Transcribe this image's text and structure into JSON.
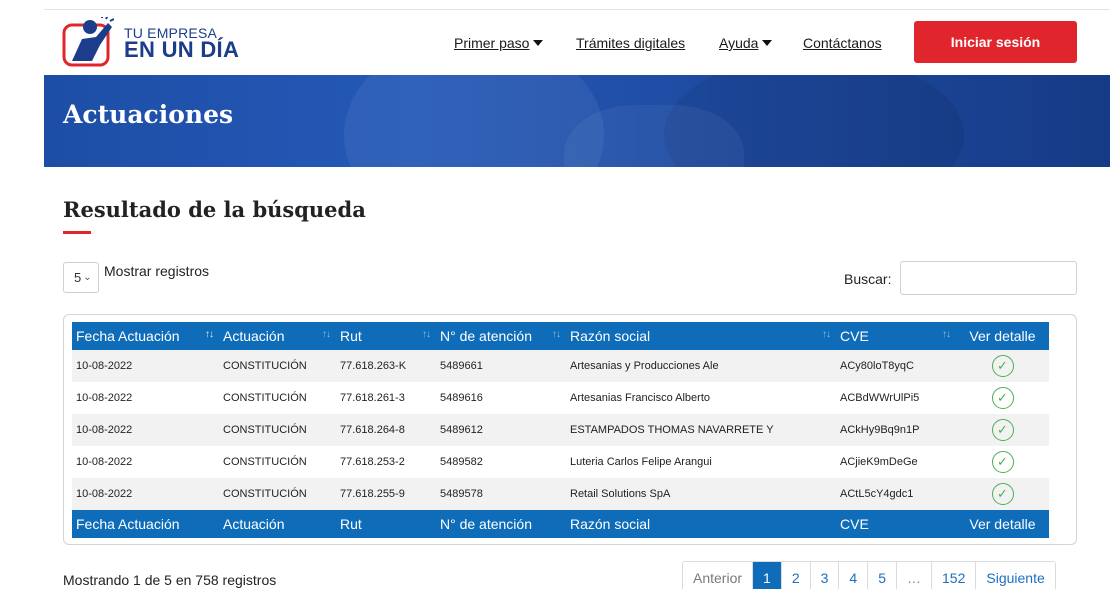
{
  "header": {
    "logo_line1": "TU EMPRESA",
    "logo_line2": "EN UN DÍA",
    "nav": [
      {
        "label": "Primer paso",
        "dropdown": true
      },
      {
        "label": "Trámites digitales",
        "dropdown": false
      },
      {
        "label": "Ayuda",
        "dropdown": true
      },
      {
        "label": "Contáctanos",
        "dropdown": false
      }
    ],
    "login_label": "Iniciar sesión"
  },
  "banner": {
    "title": "Actuaciones"
  },
  "section": {
    "title": "Resultado de la búsqueda"
  },
  "controls": {
    "page_length": "5",
    "page_length_label": "Mostrar registros",
    "search_label": "Buscar:",
    "search_value": ""
  },
  "table": {
    "columns": [
      "Fecha Actuación",
      "Actuación",
      "Rut",
      "N° de atención",
      "Razón social",
      "CVE",
      "Ver detalle"
    ],
    "rows": [
      [
        "10-08-2022",
        "CONSTITUCIÓN",
        "77.618.263-K",
        "5489661",
        "Artesanias y Producciones Ale",
        "ACy80loT8yqC"
      ],
      [
        "10-08-2022",
        "CONSTITUCIÓN",
        "77.618.261-3",
        "5489616",
        "Artesanias Francisco Alberto",
        "ACBdWWrUlPi5"
      ],
      [
        "10-08-2022",
        "CONSTITUCIÓN",
        "77.618.264-8",
        "5489612",
        "ESTAMPADOS THOMAS NAVARRETE Y",
        "ACkHy9Bq9n1P"
      ],
      [
        "10-08-2022",
        "CONSTITUCIÓN",
        "77.618.253-2",
        "5489582",
        "Luteria Carlos Felipe Arangui",
        "ACjieK9mDeGe"
      ],
      [
        "10-08-2022",
        "CONSTITUCIÓN",
        "77.618.255-9",
        "5489578",
        "Retail Solutions SpA",
        "ACtL5cY4gdc1"
      ]
    ]
  },
  "footer": {
    "info": "Mostrando 1 de 5 en 758 registros",
    "pagination": {
      "previous": "Anterior",
      "pages": [
        "1",
        "2",
        "3",
        "4",
        "5",
        "…",
        "152"
      ],
      "current": "1",
      "next": "Siguiente"
    }
  },
  "colors": {
    "brand_blue": "#0e6cb9",
    "banner_blue": "#2559b7",
    "accent_red": "#e0262c",
    "check_green": "#4caf50"
  },
  "icons": [
    "logo-mark-icon",
    "caret-down-icon",
    "chevron-down-icon",
    "sort-icon",
    "check-circle-icon"
  ]
}
